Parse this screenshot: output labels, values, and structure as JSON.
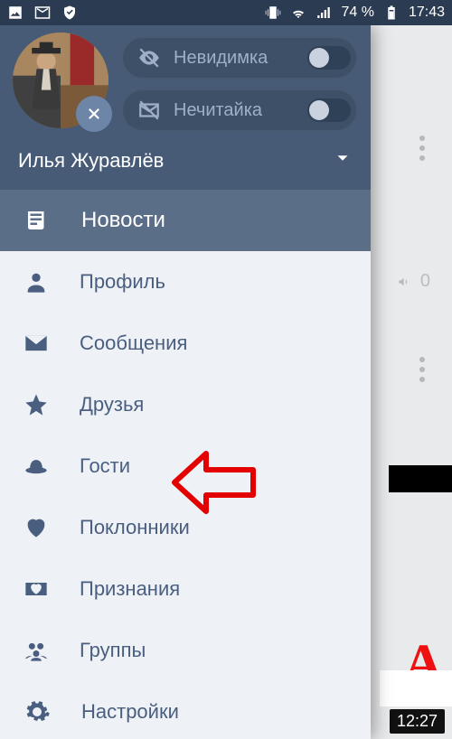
{
  "status": {
    "battery_pct": "74 %",
    "time": "17:43"
  },
  "header": {
    "user_name": "Илья Журавлёв",
    "toggles": [
      {
        "key": "invisible",
        "label": "Невидимка"
      },
      {
        "key": "noread",
        "label": "Нечитайка"
      }
    ]
  },
  "nav": {
    "active": {
      "key": "news",
      "label": "Новости"
    },
    "items": [
      {
        "key": "profile",
        "label": "Профиль"
      },
      {
        "key": "messages",
        "label": "Сообщения"
      },
      {
        "key": "friends",
        "label": "Друзья"
      },
      {
        "key": "guests",
        "label": "Гости"
      },
      {
        "key": "admirers",
        "label": "Поклонники"
      },
      {
        "key": "confess",
        "label": "Признания"
      },
      {
        "key": "groups",
        "label": "Группы"
      },
      {
        "key": "settings",
        "label": "Настройки"
      }
    ]
  },
  "background": {
    "speaker_count": "0",
    "video_time": "12:27",
    "red_letter": "A"
  }
}
